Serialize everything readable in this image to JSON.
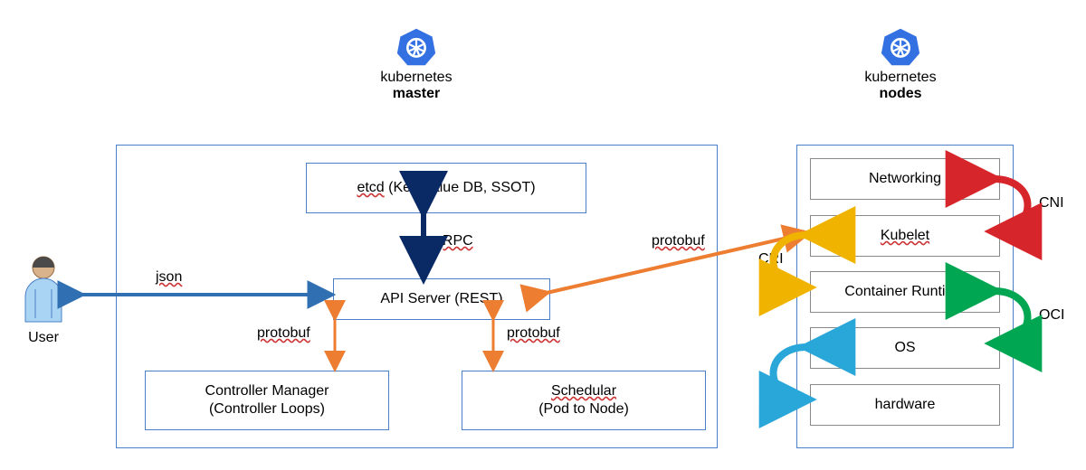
{
  "titles": {
    "master_prefix": "kubernetes",
    "master_bold": "master",
    "nodes_prefix": "kubernetes",
    "nodes_bold": "nodes"
  },
  "user_label": "User",
  "master": {
    "etcd_plain": "etcd",
    "etcd_rest": " (Key-Value DB, SSOT)",
    "api": "API Server (REST)",
    "ctrl_l1": "Controller Manager",
    "ctrl_l2": "(Controller Loops)",
    "sched_l1": "Schedular",
    "sched_l2": "(Pod to Node)"
  },
  "nodes": {
    "networking": "Networking",
    "kubelet": "Kubelet",
    "runtime": "Container Runtime",
    "os": "OS",
    "hardware": "hardware"
  },
  "edges": {
    "json": "json",
    "grpc": "gRPC",
    "protobuf1": "protobuf",
    "protobuf2": "protobuf",
    "protobuf_big": "protobuf",
    "cni": "CNI",
    "cri": "CRI",
    "oci": "OCI"
  },
  "colors": {
    "blue": "#2f6fb2",
    "navy": "#0a2a66",
    "orange": "#ed7d31",
    "green": "#00a651",
    "red": "#d7262b",
    "cyan": "#2aa7d9",
    "gold": "#f0b400",
    "k8s": "#3371e3"
  }
}
